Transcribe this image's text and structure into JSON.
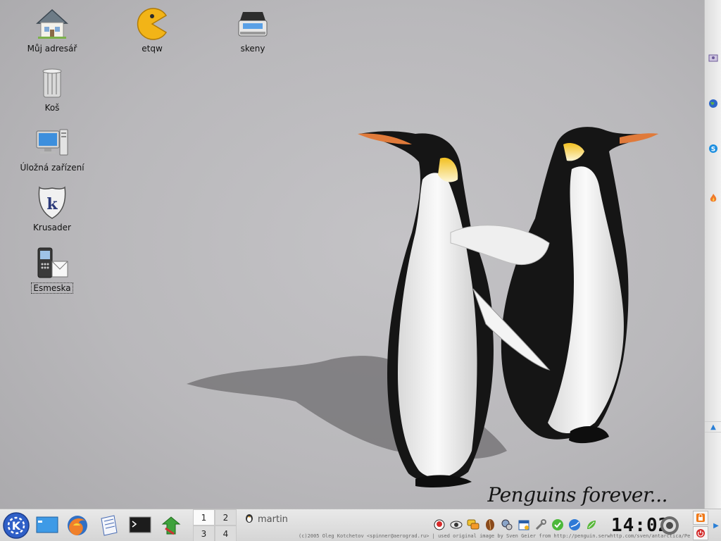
{
  "desktop": {
    "icons": [
      {
        "label": "Můj adresář",
        "icon": "home-folder-icon"
      },
      {
        "label": "etqw",
        "icon": "pacman-icon"
      },
      {
        "label": "skeny",
        "icon": "scanner-icon"
      },
      {
        "label": "Koš",
        "icon": "trash-icon"
      },
      {
        "label": "Úložná zařízení",
        "icon": "computer-icon"
      },
      {
        "label": "Krusader",
        "icon": "krusader-icon"
      },
      {
        "label": "Esmeska",
        "icon": "phone-sms-icon"
      }
    ]
  },
  "wallpaper": {
    "caption": "Penguins forever...",
    "credit": "(c)2005 Oleg Kotchetov <spinner@aerograd.ru> | used original image by  Sven Geier from http://penguin.serwhttp.com/sven/antarctica/Penguins"
  },
  "side_panel": {
    "icons": [
      "network-icon",
      "globe-icon",
      "skype-icon",
      "flame-icon"
    ],
    "arrow": "▲"
  },
  "taskbar": {
    "launchers": [
      "kde-menu-icon",
      "desktop-icon",
      "firefox-icon",
      "editor-icon",
      "terminal-icon",
      "update-icon"
    ],
    "pager": [
      "1",
      "2",
      "3",
      "4"
    ],
    "active_desktop": "1",
    "user": "martin",
    "tray_icons": [
      "gadu-icon",
      "eye-icon",
      "chat-icon",
      "coffee-icon",
      "network-manager-icon",
      "calendar-icon",
      "tools-icon",
      "check-icon",
      "globe-tray-icon",
      "leaf-icon"
    ],
    "clock": "14:02",
    "hide_arrow": "▶"
  }
}
